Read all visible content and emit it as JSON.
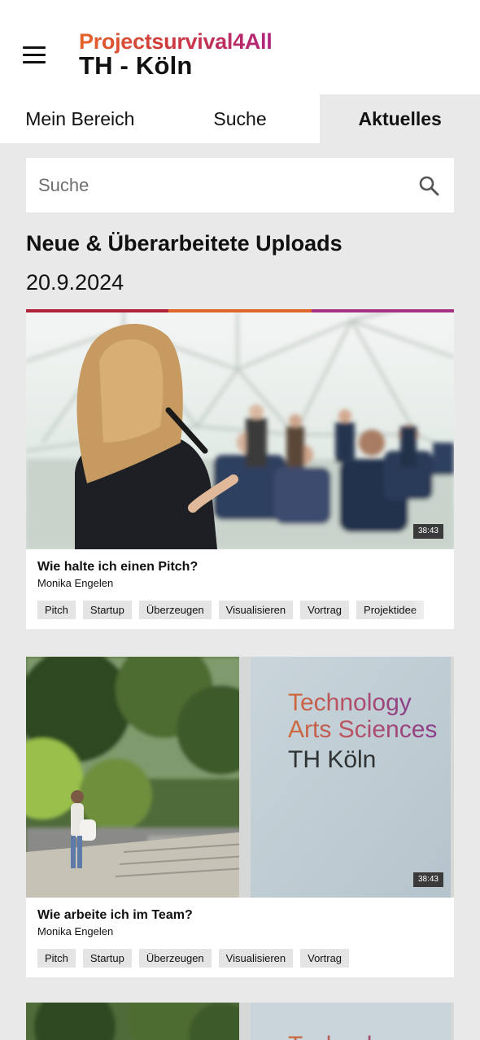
{
  "header": {
    "brand_sub": "Projectsurvival4All",
    "brand_main": "TH - Köln",
    "menu_icon": "hamburger-menu-icon"
  },
  "tabs": [
    {
      "label": "Mein Bereich",
      "active": false
    },
    {
      "label": "Suche",
      "active": false
    },
    {
      "label": "Aktuelles",
      "active": true
    }
  ],
  "search": {
    "placeholder": "Suche",
    "value": "",
    "icon": "search-icon"
  },
  "section": {
    "title": "Neue & Überarbeitete Uploads",
    "date": "20.9.2024"
  },
  "accent_colors": [
    "#b2233b",
    "#e0652c",
    "#a63283"
  ],
  "cards": [
    {
      "title": "Wie halte ich einen Pitch?",
      "author": "Monika Engelen",
      "duration": "38:43",
      "image": "woman-speaking-to-audience-photo",
      "tags": [
        "Pitch",
        "Startup",
        "Überzeugen",
        "Visualisieren",
        "Vortrag",
        "Projektidee"
      ]
    },
    {
      "title": "Wie arbeite ich im Team?",
      "author": "Monika Engelen",
      "duration": "38:43",
      "image": "campus-sign-photo",
      "sign_lines": [
        "Technology",
        "Arts Sciences",
        "TH Köln"
      ],
      "tags": [
        "Pitch",
        "Startup",
        "Überzeugen",
        "Visualisieren",
        "Vortrag"
      ]
    },
    {
      "title": "",
      "author": "",
      "duration": "",
      "image": "campus-sign-photo",
      "sign_lines": [
        "Technology"
      ],
      "tags": []
    }
  ]
}
